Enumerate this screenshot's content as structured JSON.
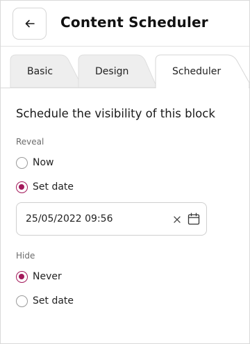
{
  "header": {
    "back_icon": "arrow-left-icon",
    "title": "Content Scheduler"
  },
  "tabs": [
    {
      "label": "Basic",
      "active": false
    },
    {
      "label": "Design",
      "active": false
    },
    {
      "label": "Scheduler",
      "active": true
    }
  ],
  "scheduler": {
    "heading": "Schedule the visibility of this block",
    "reveal": {
      "label": "Reveal",
      "options": [
        "Now",
        "Set date"
      ],
      "selected": "Set date",
      "date_value": "25/05/2022 09:56",
      "clear_icon": "close-icon",
      "calendar_icon": "calendar-icon"
    },
    "hide": {
      "label": "Hide",
      "options": [
        "Never",
        "Set date"
      ],
      "selected": "Never"
    }
  },
  "colors": {
    "accent": "#a3195b",
    "inactive_tab_bg": "#eeeeee",
    "border": "#d6d6d6"
  }
}
